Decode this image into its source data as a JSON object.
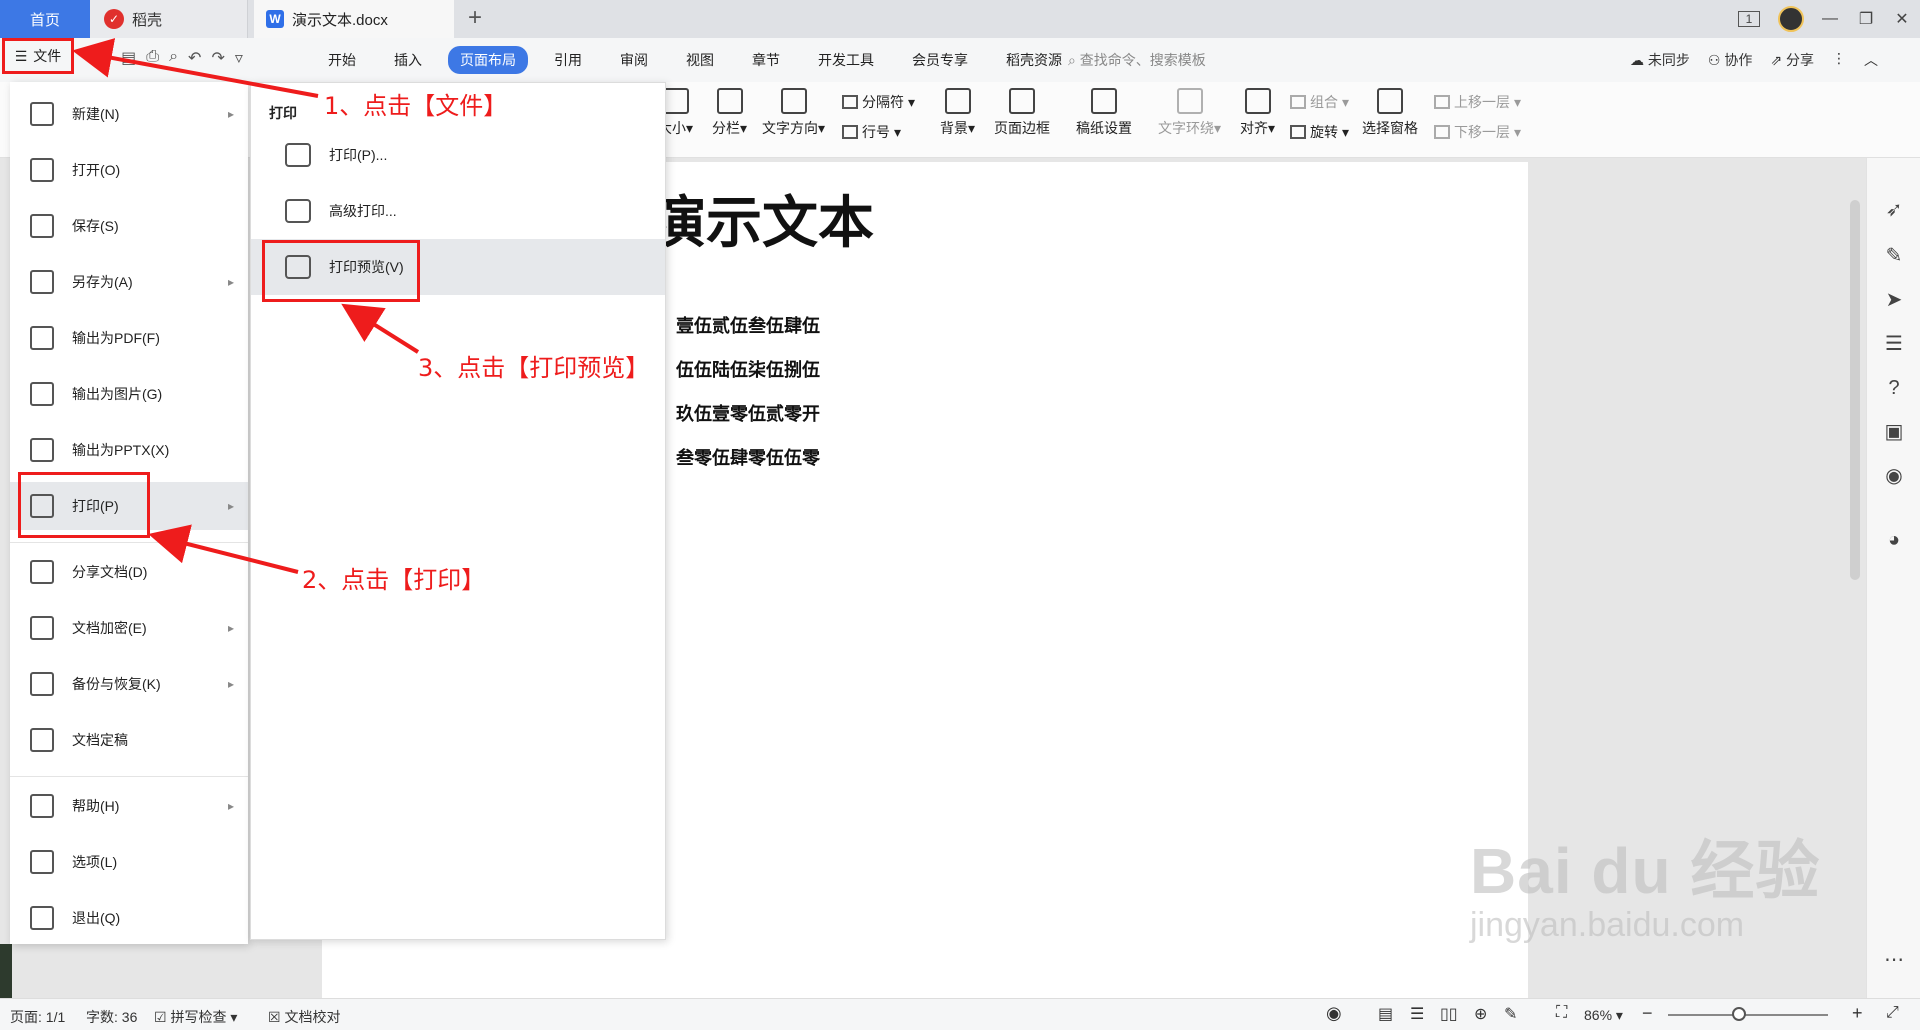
{
  "titlebar": {
    "home_tab": "首页",
    "daoke_tab": "稻壳",
    "doc_tab": "演示文本.docx",
    "add_tab": "+",
    "page_badge": "1"
  },
  "file_button": {
    "label": "文件"
  },
  "menu": {
    "items": [
      "开始",
      "插入",
      "页面布局",
      "引用",
      "审阅",
      "视图",
      "章节",
      "开发工具",
      "会员专享",
      "稻壳资源"
    ],
    "active": "页面布局",
    "search_placeholder": "查找命令、搜索模板",
    "sync": "未同步",
    "collab": "协作",
    "share": "分享"
  },
  "ribbon": {
    "size": "大小",
    "columns": "分栏",
    "text_direction": "文字方向",
    "separator": "分隔符",
    "line_number": "行号",
    "background": "背景",
    "page_border": "页面边框",
    "paper_settings": "稿纸设置",
    "text_wrap": "文字环绕",
    "align": "对齐",
    "group": "组合",
    "rotate": "旋转",
    "selection_pane": "选择窗格",
    "move_up": "上移一层",
    "move_down": "下移一层"
  },
  "file_menu": {
    "items": [
      {
        "label": "新建(N)",
        "arrow": true
      },
      {
        "label": "打开(O)",
        "arrow": false
      },
      {
        "label": "保存(S)",
        "arrow": false
      },
      {
        "label": "另存为(A)",
        "arrow": true
      },
      {
        "label": "输出为PDF(F)",
        "arrow": false
      },
      {
        "label": "输出为图片(G)",
        "arrow": false
      },
      {
        "label": "输出为PPTX(X)",
        "arrow": false
      },
      {
        "label": "打印(P)",
        "arrow": true
      },
      {
        "label": "分享文档(D)",
        "arrow": false
      },
      {
        "label": "文档加密(E)",
        "arrow": true
      },
      {
        "label": "备份与恢复(K)",
        "arrow": true
      },
      {
        "label": "文档定稿",
        "arrow": false
      },
      {
        "label": "帮助(H)",
        "arrow": true
      },
      {
        "label": "选项(L)",
        "arrow": false
      },
      {
        "label": "退出(Q)",
        "arrow": false
      }
    ]
  },
  "print_submenu": {
    "title": "打印",
    "items": [
      "打印(P)...",
      "高级打印...",
      "打印预览(V)"
    ]
  },
  "document": {
    "title": "演示文本",
    "lines": [
      "壹伍贰伍叁伍肆伍",
      "伍伍陆伍柒伍捌伍",
      "玖伍壹零伍贰零开",
      "叁零伍肆零伍伍零"
    ]
  },
  "annotations": {
    "step1": "1、点击【文件】",
    "step2": "2、点击【打印】",
    "step3": "3、点击【打印预览】"
  },
  "statusbar": {
    "page": "页面: 1/1",
    "word_count": "字数: 36",
    "spell_check": "拼写检查",
    "doc_proof": "文档校对",
    "zoom": "86%"
  },
  "watermark": {
    "logo": "Bai du 经验",
    "url": "jingyan.baidu.com"
  },
  "colors": {
    "accent": "#3d78e5",
    "annotation": "#ee1c1c"
  }
}
